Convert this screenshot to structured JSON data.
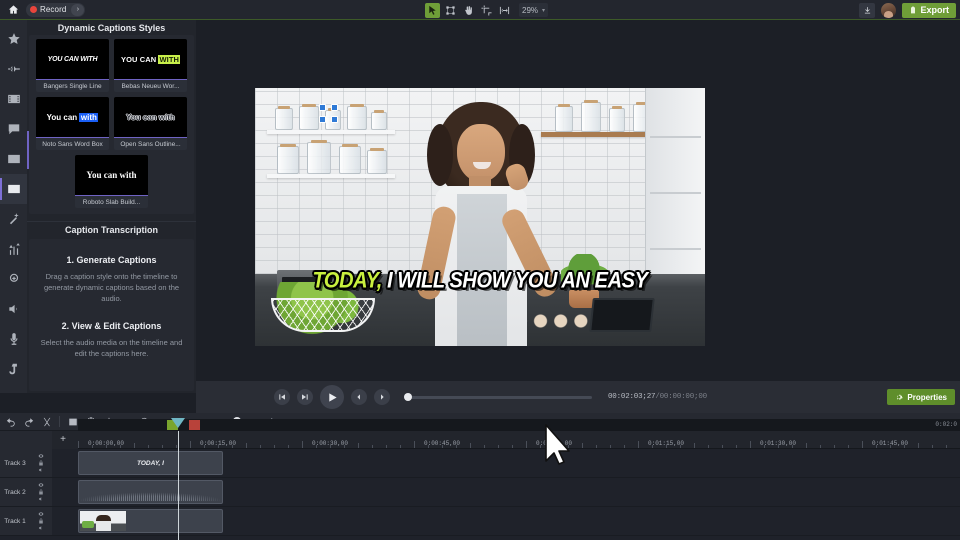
{
  "topbar": {
    "home_icon": "home-icon",
    "record_label": "Record",
    "record_arrow": "›",
    "tools": [
      {
        "name": "select-tool",
        "icon": "cursor-arrow-icon",
        "active": true
      },
      {
        "name": "node-tool",
        "icon": "nodes-icon",
        "active": false
      },
      {
        "name": "hand-tool",
        "icon": "hand-icon",
        "active": false
      },
      {
        "name": "crop-tool",
        "icon": "crop-icon",
        "active": false
      },
      {
        "name": "fit-tool",
        "icon": "fit-width-icon",
        "active": false
      }
    ],
    "zoom_value": "29%",
    "zoom_caret": "▾",
    "download_icon": "download-icon",
    "avatar": "user-avatar",
    "export_label": "Export",
    "export_color": "#6f9e38"
  },
  "rail": {
    "items": [
      {
        "name": "sidebar-item-favorites",
        "icon": "star-icon",
        "active": false
      },
      {
        "name": "sidebar-item-transitions",
        "icon": "transition-icon",
        "active": false
      },
      {
        "name": "sidebar-item-media",
        "icon": "film-strip-icon",
        "active": false
      },
      {
        "name": "sidebar-item-annotations",
        "icon": "callout-icon",
        "active": false
      },
      {
        "name": "sidebar-item-backgrounds",
        "icon": "image-icon",
        "active": false
      },
      {
        "name": "sidebar-item-captions",
        "icon": "cc-icon",
        "active": true
      },
      {
        "name": "sidebar-item-effects",
        "icon": "magic-wand-icon",
        "active": false
      },
      {
        "name": "sidebar-item-audio-fx",
        "icon": "audio-levels-icon",
        "active": false
      },
      {
        "name": "sidebar-item-cursor-fx",
        "icon": "cursor-effects-icon",
        "active": false
      },
      {
        "name": "sidebar-item-audio",
        "icon": "speaker-icon",
        "active": false
      },
      {
        "name": "sidebar-item-voice",
        "icon": "microphone-icon",
        "active": false
      },
      {
        "name": "sidebar-item-gestures",
        "icon": "hand-pointer-icon",
        "active": false
      }
    ]
  },
  "captions_panel": {
    "title": "Dynamic Captions Styles",
    "styles": [
      {
        "name": "Bangers Single Line",
        "preview": "YOU CAN WITH",
        "variant": "s1"
      },
      {
        "name": "Bebas Neueu Wor...",
        "preview_plain": "YOU CAN ",
        "preview_hl": "WITH",
        "variant": "s2"
      },
      {
        "name": "Noto Sans Word Box",
        "preview_plain": "You can ",
        "preview_hl": "with",
        "variant": "s3"
      },
      {
        "name": "Open Sans Outline...",
        "preview": "You can with",
        "variant": "s4"
      },
      {
        "name": "Roboto Slab Build...",
        "preview": "You can with",
        "variant": "s5"
      }
    ],
    "transcription_title": "Caption Transcription",
    "steps": [
      {
        "heading": "1. Generate Captions",
        "body": "Drag a caption style onto the timeline to generate dynamic captions based on the audio."
      },
      {
        "heading": "2. View & Edit Captions",
        "body": "Select the audio media on the timeline and edit the captions here."
      }
    ]
  },
  "preview": {
    "caption_highlight": "TODAY,",
    "caption_rest": " I WILL SHOW YOU AN EASY"
  },
  "transport": {
    "buttons": [
      {
        "name": "step-back-button",
        "icon": "prev-frame-icon"
      },
      {
        "name": "step-forward-button",
        "icon": "next-frame-icon"
      },
      {
        "name": "play-button",
        "icon": "play-icon"
      },
      {
        "name": "prev-marker-button",
        "icon": "chevron-left-icon"
      },
      {
        "name": "next-marker-button",
        "icon": "chevron-right-icon"
      }
    ],
    "current_time": "00:02:03;27",
    "separator": "/",
    "total_time": "00:00:00;00",
    "properties_label": "Properties",
    "properties_color": "#5f8e2b"
  },
  "timeline": {
    "tools": [
      {
        "name": "undo-button",
        "icon": "undo-icon"
      },
      {
        "name": "redo-button",
        "icon": "redo-icon"
      },
      {
        "name": "cut-button",
        "icon": "scissors-icon"
      },
      {
        "name": "properties-list-button",
        "icon": "list-icon"
      },
      {
        "name": "copy-button",
        "icon": "clipboard-icon"
      },
      {
        "name": "split-button",
        "icon": "split-icon"
      },
      {
        "name": "crop-timeline-button",
        "icon": "crop-icon"
      },
      {
        "name": "zoom-button",
        "icon": "magnifier-icon"
      }
    ],
    "zoom_minus": "−",
    "zoom_plus": "+",
    "expand_icon": "expand-timeline-icon",
    "end_label": "0:02:0",
    "add_track_label": "+",
    "collapse_caret": "⌄",
    "ruler_labels": [
      "0:00:00,00",
      "0:00:15,00",
      "0:00:30,00",
      "0:00:45,00",
      "0:01:00,00",
      "0:01:15,00",
      "0:01:30,00",
      "0:01:45,00"
    ],
    "tracks": [
      {
        "label": "Track 3",
        "clip_text": "TODAY, I",
        "type": "caption"
      },
      {
        "label": "Track 2",
        "clip_text": "",
        "type": "audio"
      },
      {
        "label": "Track 1",
        "clip_text": "",
        "type": "video"
      }
    ]
  }
}
